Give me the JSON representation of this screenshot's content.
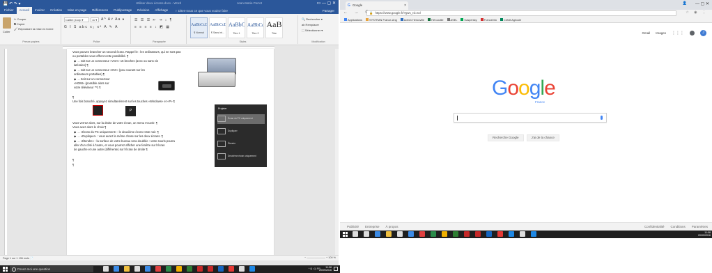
{
  "word": {
    "title_bar": {
      "qat": "💾 ↶ ↷ ▾",
      "document_title": "Utiliser deux écrans.docx - Word",
      "user": "Jean-Marie Perret",
      "window_controls": "▭ — ▢ ✕"
    },
    "tabs": [
      "Fichier",
      "Accueil",
      "Insérer",
      "Création",
      "Mise en page",
      "Références",
      "Publipostage",
      "Révision",
      "Affichage"
    ],
    "tell_me": "♀ Dites-nous ce que vous voulez faire",
    "share": "Partager",
    "ribbon": {
      "clipboard": {
        "paste": "Coller",
        "cut": "✂ Couper",
        "copy": "⧉ Copier",
        "format_painter": "🖌 Reproduire la mise en forme",
        "label": "Presse-papiers"
      },
      "font": {
        "font_name": "Calibri (Corp ▾",
        "font_size": "11 ▾",
        "row1": "A^ A˅ Aa ♦",
        "row2": "G I S abc x₂ x² A ✎ A",
        "label": "Police"
      },
      "paragraph": {
        "row1": "☰ ☰ ☰ ⇤ ⇥ ↕ ¶",
        "row2": "≡ ≡ ≡ ≡ ↕ ◩ ▦",
        "label": "Paragraphe"
      },
      "styles": {
        "items": [
          {
            "preview": "AaBbCcDc",
            "name": "¶ Normal"
          },
          {
            "preview": "AaBbCcDc",
            "name": "¶ Sans int..."
          },
          {
            "preview": "AaBbC",
            "name": "Titre 1"
          },
          {
            "preview": "AaBbCc",
            "name": "Titre 2"
          },
          {
            "preview": "AaB",
            "name": "Titre"
          }
        ],
        "label": "Styles"
      },
      "editing": {
        "find": "🔍 Rechercher ▾",
        "replace": "ab Remplacer",
        "select": "⬚ Sélectionner ▾",
        "label": "Modification"
      }
    },
    "document": {
      "lines": [
        "Vous pouvez brancher un second écran. Rappel le : les ordinateurs, qui ne sont pas",
        "ou portables vous offrent cette possibilité. ¶",
        "  ◆ → soit sur un connecteur «VGA» 15 broches (avec ou sans vis",
        "     latérales) ¶",
        "  ◆ → soit sur un connecteur «DVI» (peu courant sur les",
        "     ordinateurs portables) ¶",
        "  ◆ → Soit sur un connecteur",
        "     «HDMI» (possible alors sur",
        "     votre téléviseur ™) ¶",
        "¶",
        "Une fois branché, appuyez simultanément sur les touches «Windows» et «P» ¶",
        "Vous verrez alors, sur la droite de votre écran, un menu s'ouvrir. ¶",
        "Vous avez alors le choix ¶",
        "  ◆ → «Écran du PC uniquement» : le deuxième écran reste noir. ¶",
        "  ◆ → «Dupliquer» : vous aurez la même chose sur les deux écrans. ¶",
        "  ◆ → «Étendre» : la surface de votre bureau sera doublée : votre souris pourra",
        "     aller d'un côté à l'autre, et vous pourrez afficher une fenêtre sur l'écran",
        "     de gauche et une autre (différente) sur l'écran de droite ¶",
        "¶",
        "¶"
      ],
      "key_p": "P",
      "projection_panel": {
        "title": "Projeter",
        "items": [
          "Écran du PC uniquement",
          "Dupliquer",
          "Étendre",
          "Deuxième écran uniquement"
        ]
      }
    },
    "status_bar": {
      "page_info": "Page 1 sur 1     196 mots   📄",
      "zoom": "− ——————— + 100 %"
    }
  },
  "chrome": {
    "tab": {
      "favicon": "G",
      "title": "Google",
      "close": "×"
    },
    "window_controls": "—  ▢  ✕",
    "person_icon": "👤",
    "nav": "← → C ⌂",
    "address": "https://www.google.fr/?gws_rd=ssl",
    "address_lock": "🔒",
    "toolbar_right": "☆ ◉ ⋮",
    "bookmarks": [
      {
        "label": "Applications",
        "color": "#4285f4"
      },
      {
        "label": "SYSTRAN France-Ang",
        "color": "#e8a33d"
      },
      {
        "label": "Admin Herouville",
        "color": "#2f6fbf"
      },
      {
        "label": "Hérouville",
        "color": "#1a7340"
      },
      {
        "label": "ASEL",
        "color": "#777777"
      },
      {
        "label": "Kaspersky",
        "color": "#00a651"
      },
      {
        "label": "Franceinfo",
        "color": "#d32f2f"
      },
      {
        "label": "Crédit Agricole",
        "color": "#00875a"
      }
    ],
    "google": {
      "top_links": [
        "Gmail",
        "Images"
      ],
      "avatar_letter": "J",
      "apps_icon": "⋮⋮⋮",
      "logo_letters": [
        {
          "ch": "G",
          "color": "#4285f4"
        },
        {
          "ch": "o",
          "color": "#ea4335"
        },
        {
          "ch": "o",
          "color": "#fbbc05"
        },
        {
          "ch": "g",
          "color": "#4285f4"
        },
        {
          "ch": "l",
          "color": "#34a853"
        },
        {
          "ch": "e",
          "color": "#ea4335"
        }
      ],
      "logo_sub": "France",
      "search_button": "Recherche Google",
      "lucky_button": "J'ai de la chance",
      "footer_left": [
        "Publicité",
        "Entreprise",
        "À propos"
      ],
      "footer_right": [
        "Confidentialité",
        "Conditions",
        "Paramètres"
      ]
    }
  },
  "taskbar_right": {
    "clock_time": "11:08",
    "clock_date": "20/09/2016",
    "icon_colors": [
      "#ffffff",
      "#ffffff",
      "#3c8be6",
      "#f0c040",
      "#ffffff",
      "#3c8be6",
      "#e04040",
      "#2a8c4a",
      "#f0b000",
      "#2e7d32",
      "#c62828",
      "#c62828",
      "#1565c0",
      "#e53935",
      "#1e88e5",
      "#ffffff",
      "#1e88e5"
    ]
  },
  "taskbar_left": {
    "search": "Posez-moi une question",
    "tray": "^ ◘ ◁) FR",
    "clock_time": "11:08",
    "clock_date": "20/09/2016",
    "icon_colors": [
      "#ffffff",
      "#3c8be6",
      "#f0c040",
      "#ffffff",
      "#3c8be6",
      "#e04040",
      "#2a8c4a",
      "#f0b000",
      "#2e7d32",
      "#c62828",
      "#c62828",
      "#1565c0",
      "#e53935",
      "#ffffff",
      "#1e88e5"
    ]
  }
}
